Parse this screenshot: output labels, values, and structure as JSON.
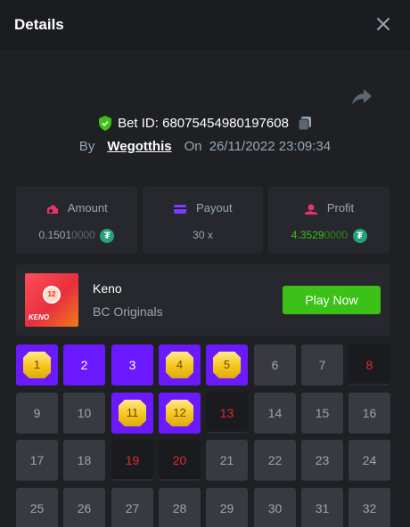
{
  "header": {
    "title": "Details"
  },
  "bet": {
    "id_label": "Bet ID: 68075454980197608",
    "by_label": "By",
    "user": "Wegotthis",
    "on_label": "On",
    "datetime": "26/11/2022 23:09:34"
  },
  "stats": {
    "amount": {
      "label": "Amount",
      "value_main": "0.1501",
      "value_dim": "0000",
      "currency_icon": "tether-coin-icon"
    },
    "payout": {
      "label": "Payout",
      "value": "30 x"
    },
    "profit": {
      "label": "Profit",
      "value_main": "4.3529",
      "value_dim": "0000",
      "currency_icon": "tether-coin-icon"
    }
  },
  "game": {
    "name": "Keno",
    "provider": "BC Originals",
    "thumb_text": "KENO",
    "thumb_ball": "12",
    "play_label": "Play Now"
  },
  "grid": {
    "cells": [
      {
        "n": "1",
        "state": "hit"
      },
      {
        "n": "2",
        "state": "sel"
      },
      {
        "n": "3",
        "state": "sel"
      },
      {
        "n": "4",
        "state": "hit"
      },
      {
        "n": "5",
        "state": "hit"
      },
      {
        "n": "6",
        "state": "none"
      },
      {
        "n": "7",
        "state": "none"
      },
      {
        "n": "8",
        "state": "miss"
      },
      {
        "n": "9",
        "state": "none"
      },
      {
        "n": "10",
        "state": "none"
      },
      {
        "n": "11",
        "state": "hit"
      },
      {
        "n": "12",
        "state": "hit"
      },
      {
        "n": "13",
        "state": "miss"
      },
      {
        "n": "14",
        "state": "none"
      },
      {
        "n": "15",
        "state": "none"
      },
      {
        "n": "16",
        "state": "none"
      },
      {
        "n": "17",
        "state": "none"
      },
      {
        "n": "18",
        "state": "none"
      },
      {
        "n": "19",
        "state": "miss"
      },
      {
        "n": "20",
        "state": "miss"
      },
      {
        "n": "21",
        "state": "none"
      },
      {
        "n": "22",
        "state": "none"
      },
      {
        "n": "23",
        "state": "none"
      },
      {
        "n": "24",
        "state": "none"
      },
      {
        "n": "25",
        "state": "none"
      },
      {
        "n": "26",
        "state": "none"
      },
      {
        "n": "27",
        "state": "none"
      },
      {
        "n": "28",
        "state": "none"
      },
      {
        "n": "29",
        "state": "none"
      },
      {
        "n": "30",
        "state": "none"
      },
      {
        "n": "31",
        "state": "none"
      },
      {
        "n": "32",
        "state": "none"
      }
    ]
  },
  "colors": {
    "accent_green": "#3bc117",
    "selected_purple": "#6b19ff",
    "miss_red": "#e02b2b",
    "gem_gold": "#f6c61a"
  }
}
